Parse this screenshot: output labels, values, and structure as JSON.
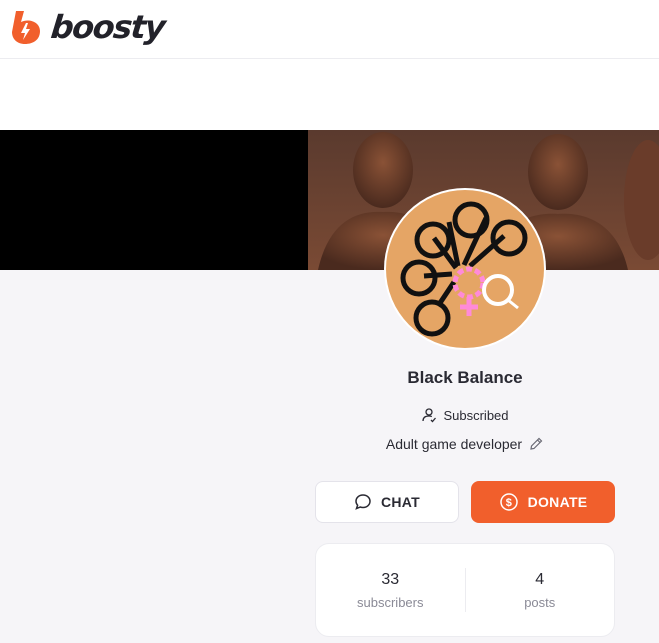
{
  "header": {
    "logo_text": "boosty",
    "brand_color": "#f15f2c"
  },
  "profile": {
    "name": "Black Balance",
    "subscription_status": "Subscribed",
    "description": "Adult game developer"
  },
  "actions": {
    "chat_label": "CHAT",
    "donate_label": "DONATE"
  },
  "stats": [
    {
      "value": "33",
      "label": "subscribers"
    },
    {
      "value": "4",
      "label": "posts"
    }
  ],
  "icons": {
    "logo": "lightning-b-icon",
    "subscribed": "user-check-icon",
    "edit": "pencil-icon",
    "chat": "chat-bubble-icon",
    "donate": "coin-dollar-icon"
  }
}
